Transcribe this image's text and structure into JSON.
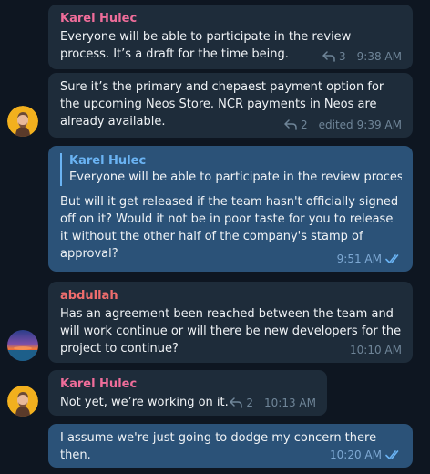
{
  "messages": [
    {
      "sender": "Karel Hulec",
      "text": "Everyone will be able to participate in the review process. It’s a draft for the time being.",
      "replies": "3",
      "time": "9:38 AM"
    },
    {
      "text": "Sure it’s the primary and chepaest payment option for the upcoming Neos Store. NCR payments in Neos are already available.",
      "replies": "2",
      "edited": "edited",
      "time": "9:39 AM"
    },
    {
      "quote_sender": "Karel Hulec",
      "quote_text": "Everyone will be able to participate in the review proces...",
      "text": "But will it get released if the team hasn't officially signed off on it? Would it not be in poor taste for you to release it without the other half of the company's stamp of approval?",
      "time": "9:51 AM"
    },
    {
      "sender": "abdullah",
      "text": "Has an agreement been reached between the team and will work continue or will there be new developers for the project to continue?",
      "time": "10:10 AM"
    },
    {
      "sender": "Karel Hulec",
      "text": "Not yet, we’re working on it.",
      "replies": "2",
      "time": "10:13 AM"
    },
    {
      "text": "I assume we're just going to dodge my concern there then.",
      "time": "10:20 AM"
    }
  ],
  "colors": {
    "background": "#0e1621",
    "incoming_bubble": "#1e2c3a",
    "outgoing_bubble": "#2b5278",
    "sender_karel": "#ef6d9a",
    "sender_abdullah": "#ef6d6d",
    "accent": "#6ab3f3"
  },
  "icons": {
    "reply": "reply-arrow-icon",
    "read": "double-check-icon"
  }
}
